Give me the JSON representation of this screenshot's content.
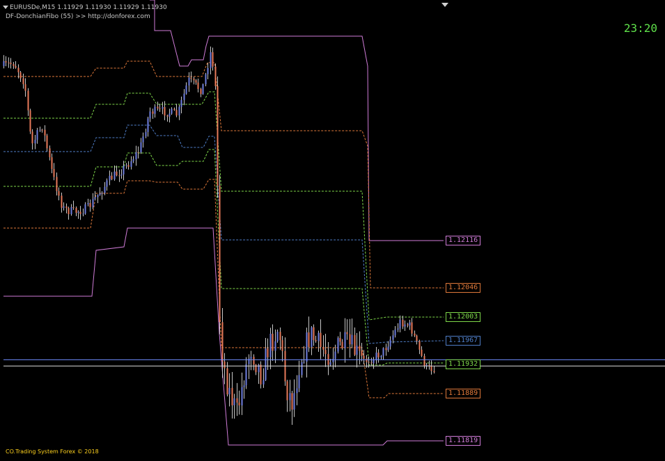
{
  "header": {
    "symbol_line": "EURUSDe,M15  1.11929 1.11930 1.11929 1.11930",
    "indicator_line": "DF-DonchianFibo (55) >> http://donforex.com"
  },
  "clock": "23:20",
  "footer": {
    "copyright": "CO.Trading System Forex  ©  2018"
  },
  "colors": {
    "background": "#000000",
    "channel_outer": "#d07cd8",
    "level_orange": "#e0793a",
    "level_green": "#7fd84a",
    "level_blue": "#4f7ec8",
    "bull_candle": "#6f7fe0",
    "bear_candle": "#e87a5a",
    "grid_line": "#d8d8d8"
  },
  "icons": [
    "dropdown-arrow-icon",
    "scroll-marker-icon"
  ],
  "price_levels": [
    {
      "value": "1.12116",
      "name": "channel-high",
      "color": "#d07cd8",
      "price": 1.12116
    },
    {
      "value": "1.12046",
      "name": "fibo-upper",
      "color": "#e0793a",
      "price": 1.12046
    },
    {
      "value": "1.12003",
      "name": "fibo-mid-high",
      "color": "#7fd84a",
      "price": 1.12003
    },
    {
      "value": "1.11967",
      "name": "fibo-mid",
      "color": "#4f7ec8",
      "price": 1.11967
    },
    {
      "value": "1.11932",
      "name": "fibo-mid-low",
      "color": "#7fd84a",
      "price": 1.11932
    },
    {
      "value": "1.11889",
      "name": "fibo-lower",
      "color": "#e0793a",
      "price": 1.11889
    },
    {
      "value": "1.11819",
      "name": "channel-low",
      "color": "#d07cd8",
      "price": 1.11819
    }
  ],
  "current_price": 1.1193
}
